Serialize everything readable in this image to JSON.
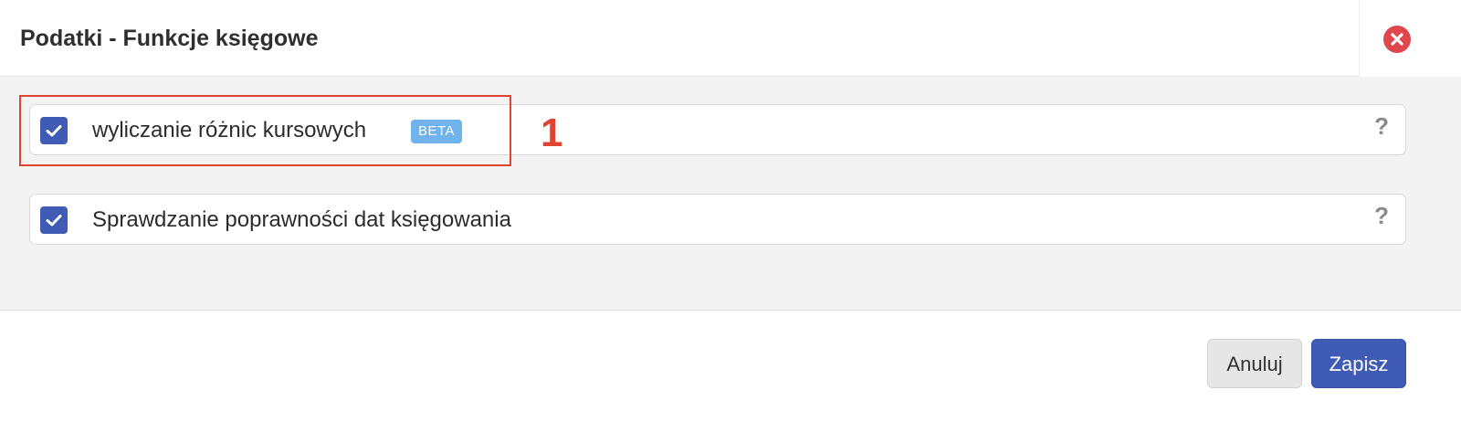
{
  "dialog": {
    "title": "Podatki - Funkcje księgowe",
    "close_icon": "close-circle-icon"
  },
  "options": [
    {
      "label": "wyliczanie różnic kursowych",
      "checked": true,
      "badge": "BETA",
      "help_icon": "?"
    },
    {
      "label": "Sprawdzanie poprawności dat księgowania",
      "checked": true,
      "help_icon": "?"
    }
  ],
  "annotation": {
    "number": "1",
    "color": "#e0432f"
  },
  "footer": {
    "cancel_label": "Anuluj",
    "save_label": "Zapisz"
  },
  "colors": {
    "accent": "#3f5bb5",
    "badge": "#6fb2ec",
    "close": "#e0474d"
  }
}
